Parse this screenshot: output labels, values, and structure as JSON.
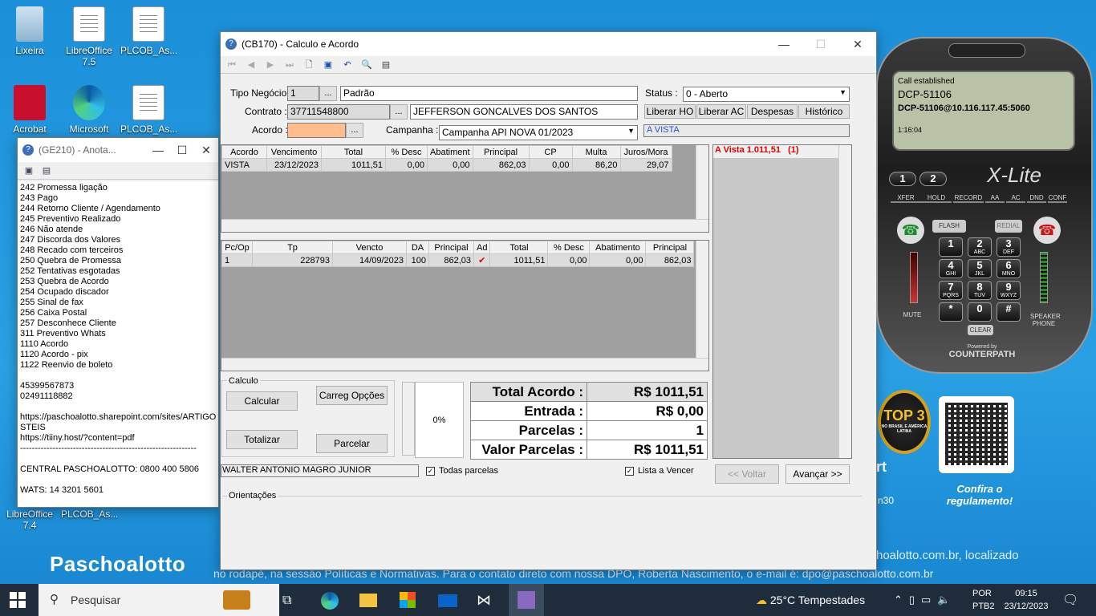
{
  "desktop": {
    "icons": [
      {
        "label": "Lixeira"
      },
      {
        "label": "LibreOffice 7.5"
      },
      {
        "label": "PLCOB_As..."
      },
      {
        "label": "Acrobat"
      },
      {
        "label": "Microsoft"
      },
      {
        "label": "PLCOB_As..."
      },
      {
        "label": "LibreOffice 7.4"
      },
      {
        "label": "PLCOB_As..."
      }
    ],
    "brand": "Paschoalotto",
    "bg_line1": "hoalotto.com.br, localizado",
    "bg_line2": "no rodapé, na sessão Políticas e Normativas. Para o contato direto com nossa DPO, Roberta Nascimento,  o e-mail é: dpo@paschoalotto.com.br",
    "badge_text": "TOP 3",
    "badge_sub": "NO BRASIL E AMÉRICA LATINA",
    "confira": "Confira o regulamento!",
    "side_t": "rt",
    "side_30": "n30"
  },
  "ge210": {
    "title": "(GE210) - Anota...",
    "lines": [
      "242 Promessa ligação",
      "243 Pago",
      "244 Retorno Cliente / Agendamento",
      "245 Preventivo Realizado",
      "246 Não atende",
      "247 Discorda dos Valores",
      "248 Recado com terceiros",
      "250 Quebra de Promessa",
      "252 Tentativas esgotadas",
      "253 Quebra de Acordo",
      "254 Ocupado discador",
      "255 Sinal de fax",
      "256 Caixa Postal",
      "257 Desconhece Cliente",
      "311 Preventivo Whats",
      "1110 Acordo",
      "1120 Acordo - pix",
      "1122 Reenvio de boleto",
      "",
      "45399567873",
      "02491118882",
      "",
      "https://paschoalotto.sharepoint.com/sites/ARTIGO",
      "STEIS",
      "https://tiiny.host/?content=pdf",
      "------------------------------------------------------------",
      "",
      "CENTRAL  PASCHOALOTTO: 0800 400 5806",
      "",
      "WATS: 14 3201 5601"
    ]
  },
  "cb170": {
    "title": "(CB170) - Calculo e Acordo",
    "labels": {
      "tipo": "Tipo Negócio :",
      "contrato": "Contrato :",
      "acordo": "Acordo :",
      "campanha": "Campanha :",
      "status": "Status :"
    },
    "tipo_code": "1",
    "tipo_desc": "Padrão",
    "contrato": "37711548800",
    "cliente": "JEFFERSON GONCALVES DOS SANTOS",
    "acordo": "",
    "campanha": "Campanha API NOVA 01/2023",
    "status": "0 - Aberto",
    "avista_field": "A VISTA",
    "buttons": {
      "liberar_ho": "Liberar HO",
      "liberar_ac": "Liberar AC",
      "despesas": "Despesas",
      "historico": "Histórico",
      "calcular": "Calcular",
      "carreg": "Carreg Opções",
      "totalizar": "Totalizar",
      "parcelar": "Parcelar",
      "voltar": "<< Voltar",
      "avancar": "Avançar >>",
      "dots": "..."
    },
    "grid1": {
      "headers": [
        "Acordo",
        "Vencimento",
        "Total",
        "% Desc",
        "Abatiment",
        "Principal",
        "CP",
        "Multa",
        "Juros/Mora"
      ],
      "rows": [
        [
          "VISTA",
          "23/12/2023",
          "1011,51",
          "0,00",
          "0,00",
          "862,03",
          "0,00",
          "86,20",
          "29,07"
        ]
      ]
    },
    "grid2": {
      "headers": [
        "Pc/Op",
        "Tp",
        "Vencto",
        "DA",
        "Principal",
        "Ad",
        "Total",
        "% Desc",
        "Abatimento",
        "Principal"
      ],
      "rows": [
        [
          "1",
          "228793",
          "14/09/2023",
          "100",
          "862,03",
          "✔",
          "1011,51",
          "0,00",
          "0,00",
          "862,03"
        ]
      ]
    },
    "side_list": {
      "item": "A Vista 1.011,51",
      "count": "(1)"
    },
    "calculo_group": "Calculo",
    "percent": "0%",
    "summary": [
      {
        "k": "Total Acordo :",
        "v": "R$ 1011,51"
      },
      {
        "k": "Entrada :",
        "v": "R$ 0,00"
      },
      {
        "k": "Parcelas :",
        "v": "1"
      },
      {
        "k": "Valor Parcelas :",
        "v": "R$ 1011,51"
      }
    ],
    "operator": "WALTER ANTONIO MAGRO JUNIOR",
    "todas_parcelas": "Todas parcelas",
    "lista_vencer": "Lista a Vencer",
    "orientacoes": "Orientações"
  },
  "xlite": {
    "status": "Call established",
    "line1": "DCP-51106",
    "line2": "DCP-51106@10.116.117.45:5060",
    "timer": "1:16:04",
    "brand": "X-Lite",
    "line_btns": [
      "1",
      "2"
    ],
    "func": [
      "XFER",
      "HOLD",
      "RECORD",
      "AA",
      "AC",
      "DND",
      "CONF"
    ],
    "flash": "FLASH",
    "redial": "REDIAL",
    "mute": "MUTE",
    "speaker": "SPEAKER PHONE",
    "clear": "CLEAR",
    "powered": "Powered by",
    "counterpath": "COUNTERPATH",
    "keys": [
      {
        "d": "1",
        "l": ""
      },
      {
        "d": "2",
        "l": "ABC"
      },
      {
        "d": "3",
        "l": "DEF"
      },
      {
        "d": "4",
        "l": "GHI"
      },
      {
        "d": "5",
        "l": "JKL"
      },
      {
        "d": "6",
        "l": "MNO"
      },
      {
        "d": "7",
        "l": "PQRS"
      },
      {
        "d": "8",
        "l": "TUV"
      },
      {
        "d": "9",
        "l": "WXYZ"
      },
      {
        "d": "*",
        "l": ""
      },
      {
        "d": "0",
        "l": ""
      },
      {
        "d": "#",
        "l": ""
      }
    ]
  },
  "taskbar": {
    "search": "Pesquisar",
    "weather": "25°C  Tempestades",
    "lang1": "POR",
    "lang2": "PTB2",
    "time": "09:15",
    "date": "23/12/2023"
  }
}
